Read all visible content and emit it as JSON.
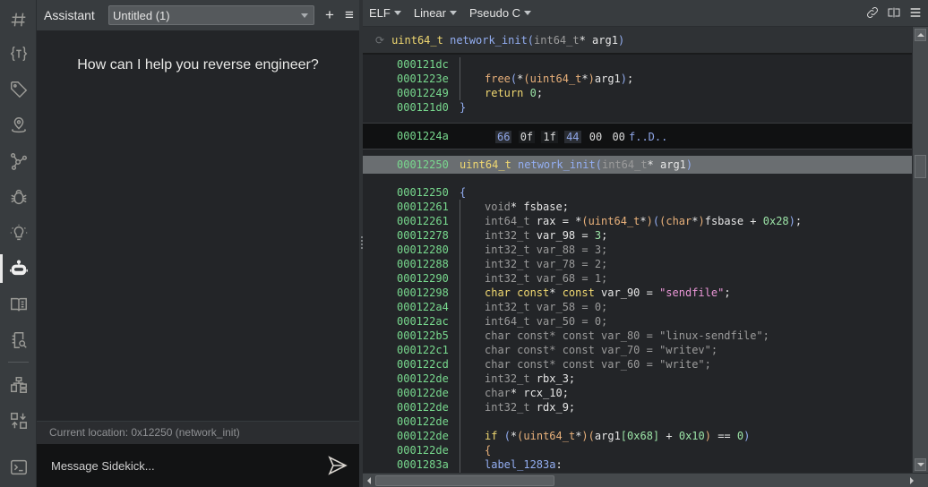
{
  "rail": {
    "items": [
      {
        "name": "logo",
        "icon": "hash-logo-icon"
      },
      {
        "name": "types",
        "icon": "type-braces-icon"
      },
      {
        "name": "tags",
        "icon": "tag-icon"
      },
      {
        "name": "locations",
        "icon": "map-pin-icon"
      },
      {
        "name": "graph",
        "icon": "graph-nodes-icon"
      },
      {
        "name": "debugger",
        "icon": "bug-icon"
      },
      {
        "name": "ideas",
        "icon": "lightbulb-icon"
      },
      {
        "name": "assistant",
        "icon": "robot-icon",
        "active": true
      },
      {
        "name": "docs",
        "icon": "book-icon"
      },
      {
        "name": "search-log",
        "icon": "search-doc-icon"
      },
      {
        "name": "hierarchy",
        "icon": "hierarchy-icon"
      },
      {
        "name": "xrefs",
        "icon": "swap-icon"
      },
      {
        "name": "console",
        "icon": "terminal-icon"
      }
    ]
  },
  "assistant": {
    "title": "Assistant",
    "session": "Untitled (1)",
    "add_label": "+",
    "menu_label": "≡",
    "prompt": "How can I help you reverse engineer?",
    "current_location": "Current location: 0x12250 (network_init)",
    "input_placeholder": "Message Sidekick..."
  },
  "toolbar": {
    "format": "ELF",
    "view": "Linear",
    "language": "Pseudo C"
  },
  "function_header": {
    "return_type": "uint64_t",
    "name": "network_init",
    "param_type": "int64_t",
    "param_rest": "* arg1"
  },
  "code": {
    "pre_lines": [
      {
        "addr": "000121dc",
        "tokens": []
      },
      {
        "addr": "0001223e",
        "indent": 1,
        "tokens": [
          [
            "c-call",
            "free"
          ],
          [
            "c-paren",
            "("
          ],
          [
            "c-id",
            "*"
          ],
          [
            "c-obr",
            "("
          ],
          [
            "c-call",
            "uint64_t"
          ],
          [
            "c-id",
            "*"
          ],
          [
            "c-obr",
            ")"
          ],
          [
            "c-id",
            "arg1"
          ],
          [
            "c-paren",
            ")"
          ],
          [
            "c-id",
            ";"
          ]
        ]
      },
      {
        "addr": "00012249",
        "indent": 1,
        "tokens": [
          [
            "c-kw",
            "return"
          ],
          [
            "c-id",
            " "
          ],
          [
            "c-num",
            "0"
          ],
          [
            "c-id",
            ";"
          ]
        ]
      },
      {
        "addr": "000121d0",
        "indent": 0,
        "tokens": [
          [
            "c-brace",
            "}"
          ]
        ]
      }
    ],
    "hex_line": {
      "addr": "0001224a",
      "bytes": [
        [
          "66",
          "hi"
        ],
        [
          "0f",
          "dim"
        ],
        [
          "1f",
          "dim"
        ],
        [
          "44",
          "hi"
        ],
        [
          "00",
          ""
        ],
        [
          "00",
          ""
        ]
      ],
      "ascii": "f..D.."
    },
    "func_line": {
      "addr": "00012250",
      "tokens": [
        [
          "c-kw",
          "uint64_t"
        ],
        [
          "c-id",
          " "
        ],
        [
          "c-fn",
          "network_init"
        ],
        [
          "c-paren",
          "("
        ],
        [
          "c-arg",
          "int64_t"
        ],
        [
          "c-id",
          "* arg1"
        ],
        [
          "c-paren",
          ")"
        ]
      ]
    },
    "body_lines": [
      {
        "addr": "00012250",
        "indent": 0,
        "tokens": [
          [
            "c-brace",
            "{"
          ]
        ]
      },
      {
        "addr": "00012261",
        "indent": 1,
        "tokens": [
          [
            "c-type",
            "void"
          ],
          [
            "c-id",
            "* fsbase;"
          ]
        ]
      },
      {
        "addr": "00012261",
        "indent": 1,
        "tokens": [
          [
            "c-type",
            "int64_t"
          ],
          [
            "c-id",
            " rax = *"
          ],
          [
            "c-obr",
            "("
          ],
          [
            "c-call",
            "uint64_t"
          ],
          [
            "c-id",
            "*"
          ],
          [
            "c-obr",
            ")"
          ],
          [
            "c-paren",
            "("
          ],
          [
            "c-obr",
            "("
          ],
          [
            "c-call",
            "char"
          ],
          [
            "c-id",
            "*"
          ],
          [
            "c-obr",
            ")"
          ],
          [
            "c-id",
            "fsbase + "
          ],
          [
            "c-num",
            "0x28"
          ],
          [
            "c-paren",
            ")"
          ],
          [
            "c-id",
            ";"
          ]
        ]
      },
      {
        "addr": "00012278",
        "indent": 1,
        "tokens": [
          [
            "c-type",
            "int32_t"
          ],
          [
            "c-id",
            " var_98 = "
          ],
          [
            "c-num",
            "3"
          ],
          [
            "c-id",
            ";"
          ]
        ]
      },
      {
        "addr": "00012280",
        "indent": 1,
        "tokens": [
          [
            "c-type",
            "int32_t var_88 = 3;"
          ]
        ]
      },
      {
        "addr": "00012288",
        "indent": 1,
        "tokens": [
          [
            "c-type",
            "int32_t var_78 = 2;"
          ]
        ]
      },
      {
        "addr": "00012290",
        "indent": 1,
        "tokens": [
          [
            "c-type",
            "int32_t var_68 = 1;"
          ]
        ]
      },
      {
        "addr": "00012298",
        "indent": 1,
        "tokens": [
          [
            "c-kw",
            "char const"
          ],
          [
            "c-id",
            "* "
          ],
          [
            "c-kw",
            "const"
          ],
          [
            "c-id",
            " var_90 = "
          ],
          [
            "c-str",
            "\"sendfile\""
          ],
          [
            "c-id",
            ";"
          ]
        ]
      },
      {
        "addr": "000122a4",
        "indent": 1,
        "tokens": [
          [
            "c-type",
            "int32_t var_58 = 0;"
          ]
        ]
      },
      {
        "addr": "000122ac",
        "indent": 1,
        "tokens": [
          [
            "c-type",
            "int64_t var_50 = 0;"
          ]
        ]
      },
      {
        "addr": "000122b5",
        "indent": 1,
        "tokens": [
          [
            "c-type",
            "char const* const var_80 = \"linux-sendfile\";"
          ]
        ]
      },
      {
        "addr": "000122c1",
        "indent": 1,
        "tokens": [
          [
            "c-type",
            "char const* const var_70 = \"writev\";"
          ]
        ]
      },
      {
        "addr": "000122cd",
        "indent": 1,
        "tokens": [
          [
            "c-type",
            "char const* const var_60 = \"write\";"
          ]
        ]
      },
      {
        "addr": "000122de",
        "indent": 1,
        "tokens": [
          [
            "c-type",
            "int32_t"
          ],
          [
            "c-id",
            " rbx_3;"
          ]
        ]
      },
      {
        "addr": "000122de",
        "indent": 1,
        "tokens": [
          [
            "c-type",
            "char"
          ],
          [
            "c-id",
            "* rcx_10;"
          ]
        ]
      },
      {
        "addr": "000122de",
        "indent": 1,
        "tokens": [
          [
            "c-type",
            "int32_t"
          ],
          [
            "c-id",
            " rdx_9;"
          ]
        ]
      },
      {
        "addr": "000122de",
        "indent": 1,
        "tokens": []
      },
      {
        "addr": "000122de",
        "indent": 1,
        "tokens": [
          [
            "c-kw",
            "if"
          ],
          [
            "c-id",
            " "
          ],
          [
            "c-paren",
            "("
          ],
          [
            "c-id",
            "*"
          ],
          [
            "c-obr",
            "("
          ],
          [
            "c-call",
            "uint64_t"
          ],
          [
            "c-id",
            "*"
          ],
          [
            "c-obr",
            ")"
          ],
          [
            "c-obr",
            "("
          ],
          [
            "c-id",
            "arg1"
          ],
          [
            "c-num",
            "[0x68]"
          ],
          [
            "c-id",
            " + "
          ],
          [
            "c-num",
            "0x10"
          ],
          [
            "c-obr",
            ")"
          ],
          [
            "c-id",
            " == "
          ],
          [
            "c-num",
            "0"
          ],
          [
            "c-paren",
            ")"
          ]
        ]
      },
      {
        "addr": "000122de",
        "indent": 1,
        "tokens": [
          [
            "c-obr",
            "{"
          ]
        ]
      },
      {
        "addr": "0001283a",
        "indent": 1,
        "tokens": [
          [
            "c-lbl",
            "label_1283a"
          ],
          [
            "c-id",
            ":"
          ]
        ]
      }
    ]
  }
}
